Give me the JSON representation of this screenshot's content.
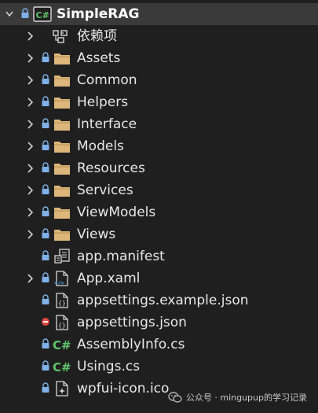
{
  "solution_explorer": {
    "project": {
      "name": "SimpleRAG",
      "icon": "csharp-project-icon"
    },
    "items": [
      {
        "label": "依赖项",
        "icon": "dependencies-icon",
        "expandable": true,
        "lock": false
      },
      {
        "label": "Assets",
        "icon": "folder-icon",
        "expandable": true,
        "lock": true
      },
      {
        "label": "Common",
        "icon": "folder-icon",
        "expandable": true,
        "lock": true
      },
      {
        "label": "Helpers",
        "icon": "folder-icon",
        "expandable": true,
        "lock": true
      },
      {
        "label": "Interface",
        "icon": "folder-icon",
        "expandable": true,
        "lock": true
      },
      {
        "label": "Models",
        "icon": "folder-icon",
        "expandable": true,
        "lock": true
      },
      {
        "label": "Resources",
        "icon": "folder-icon",
        "expandable": true,
        "lock": true
      },
      {
        "label": "Services",
        "icon": "folder-icon",
        "expandable": true,
        "lock": true
      },
      {
        "label": "ViewModels",
        "icon": "folder-icon",
        "expandable": true,
        "lock": true
      },
      {
        "label": "Views",
        "icon": "folder-icon",
        "expandable": true,
        "lock": true
      },
      {
        "label": "app.manifest",
        "icon": "manifest-icon",
        "expandable": false,
        "lock": true
      },
      {
        "label": "App.xaml",
        "icon": "xaml-file-icon",
        "expandable": true,
        "lock": true
      },
      {
        "label": "appsettings.example.json",
        "icon": "json-file-icon",
        "expandable": false,
        "lock": true
      },
      {
        "label": "appsettings.json",
        "icon": "json-file-icon",
        "expandable": false,
        "lock": false,
        "excluded": true
      },
      {
        "label": "AssemblyInfo.cs",
        "icon": "csharp-file-icon",
        "expandable": false,
        "lock": true
      },
      {
        "label": "Usings.cs",
        "icon": "csharp-file-icon",
        "expandable": false,
        "lock": true
      },
      {
        "label": "wpfui-icon.ico",
        "icon": "ico-file-icon",
        "expandable": false,
        "lock": true
      }
    ]
  },
  "watermark": {
    "text": "公众号 · mingupup的学习记录"
  },
  "colors": {
    "background": "#1f1f1f",
    "selected_row": "#3a3a3a",
    "folder": "#dcb67a",
    "lock": "#7fb1e8",
    "csharp": "#60c46a",
    "excluded": "#e2473e"
  }
}
